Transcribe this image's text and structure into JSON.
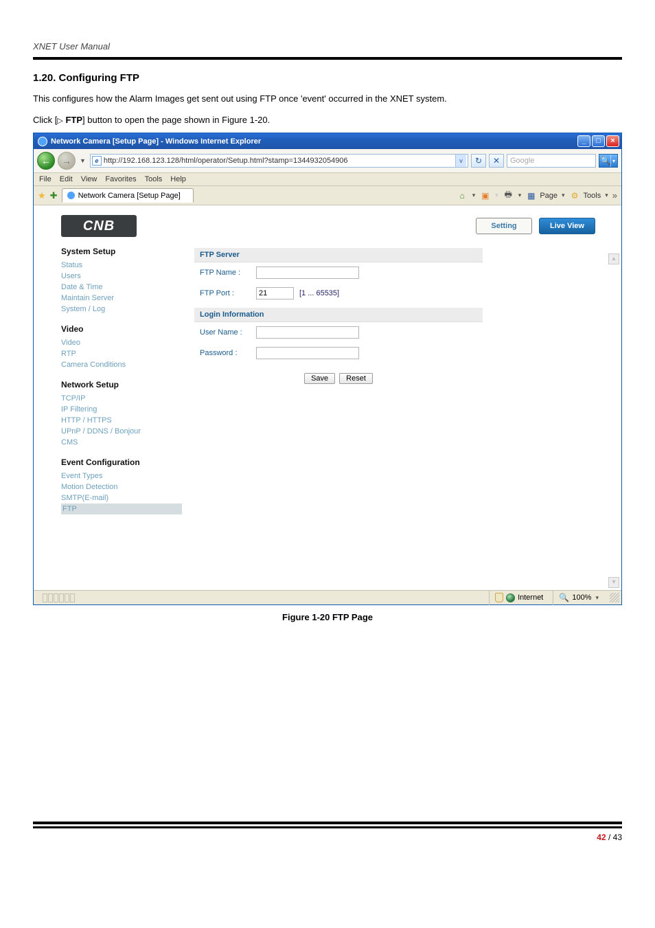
{
  "doc": {
    "header": "XNET User Manual",
    "section_title": "1.20. Configuring FTP",
    "intro": "This configures how the Alarm Images get sent out using FTP once 'event' occurred in the XNET system.",
    "step_prefix": "Click [",
    "step_icon": "▷",
    "step_btn": "FTP",
    "step_suffix": "] button to open the page shown in Figure 1-20.",
    "caption": "Figure 1-20 FTP Page",
    "page_cur": "42",
    "page_sep": " / ",
    "page_total": "43"
  },
  "browser": {
    "title": "Network Camera [Setup Page] - Windows Internet Explorer",
    "url": "http://192.168.123.128/html/operator/Setup.html?stamp=1344932054906",
    "search_placeholder": "Google",
    "menu": [
      "File",
      "Edit",
      "View",
      "Favorites",
      "Tools",
      "Help"
    ],
    "tab_label": "Network Camera [Setup Page]",
    "toolbar": {
      "page": "Page",
      "tools": "Tools"
    },
    "status_zone": "Internet",
    "zoom": "100%"
  },
  "app": {
    "logo": "CNB",
    "btn_setting": "Setting",
    "btn_live": "Live View",
    "sidebar": {
      "groups": [
        {
          "head": "System Setup",
          "items": [
            "Status",
            "Users",
            "Date & Time",
            "Maintain Server",
            "System / Log"
          ]
        },
        {
          "head": "Video",
          "items": [
            "Video",
            "RTP",
            "Camera Conditions"
          ]
        },
        {
          "head": "Network Setup",
          "items": [
            "TCP/IP",
            "IP Filtering",
            "HTTP / HTTPS",
            "UPnP / DDNS / Bonjour",
            "CMS"
          ]
        },
        {
          "head": "Event Configuration",
          "items": [
            "Event Types",
            "Motion Detection",
            "SMTP(E-mail)",
            "FTP"
          ]
        }
      ],
      "selected": "FTP"
    },
    "form": {
      "section1": "FTP Server",
      "ftp_name_label": "FTP Name :",
      "ftp_name_value": "",
      "ftp_port_label": "FTP Port :",
      "ftp_port_value": "21",
      "ftp_port_hint": "[1 ... 65535]",
      "section2": "Login Information",
      "user_label": "User Name :",
      "user_value": "",
      "pass_label": "Password :",
      "pass_value": "",
      "save": "Save",
      "reset": "Reset"
    }
  }
}
